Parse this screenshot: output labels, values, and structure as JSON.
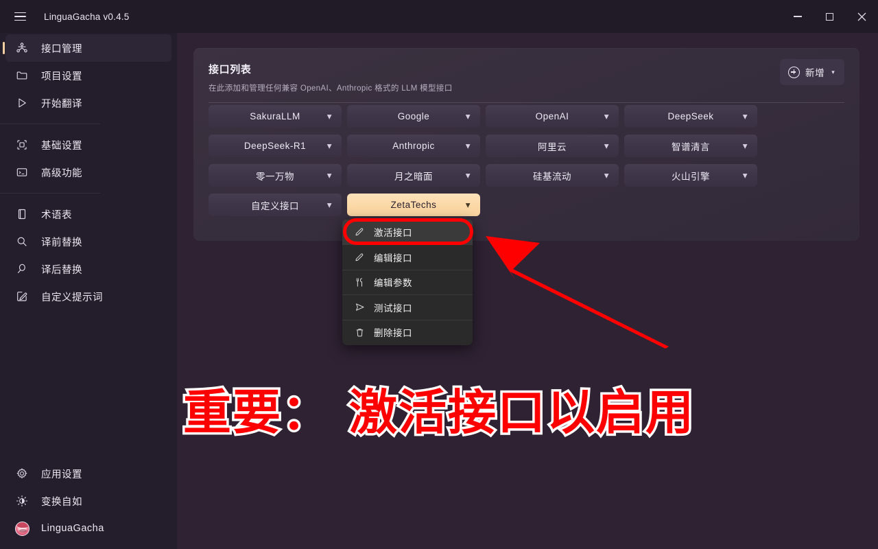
{
  "window": {
    "title": "LinguaGacha v0.4.5",
    "menu_icon": "hamburger-icon",
    "controls": {
      "minimize": "minimize-icon",
      "maximize": "maximize-icon",
      "close": "close-icon"
    }
  },
  "sidebar": {
    "top_items": [
      {
        "label": "接口管理",
        "icon": "network-nodes-icon",
        "active": true
      },
      {
        "label": "项目设置",
        "icon": "folder-icon",
        "active": false
      },
      {
        "label": "开始翻译",
        "icon": "play-triangle-icon",
        "active": false
      }
    ],
    "mid_items": [
      {
        "label": "基础设置",
        "icon": "cube-outline-icon",
        "active": false
      },
      {
        "label": "高级功能",
        "icon": "terminal-icon",
        "active": false
      }
    ],
    "tool_items": [
      {
        "label": "术语表",
        "icon": "book-icon",
        "active": false
      },
      {
        "label": "译前替换",
        "icon": "search-icon",
        "active": false
      },
      {
        "label": "译后替换",
        "icon": "search-alt-icon",
        "active": false
      },
      {
        "label": "自定义提示词",
        "icon": "edit-square-icon",
        "active": false
      }
    ],
    "bottom_items": [
      {
        "label": "应用设置",
        "icon": "gear-icon",
        "active": false
      },
      {
        "label": "变换自如",
        "icon": "brightness-icon",
        "active": false
      },
      {
        "label": "LinguaGacha",
        "icon": "avatar",
        "active": false
      }
    ]
  },
  "card": {
    "title": "接口列表",
    "subtitle": "在此添加和管理任何兼容 OpenAI、Anthropic 格式的 LLM 模型接口",
    "add_button": {
      "label": "新增",
      "icon": "plus-circle-icon",
      "caret": "chevron-down-icon"
    }
  },
  "interfaces": [
    {
      "label": "SakuraLLM",
      "active": false
    },
    {
      "label": "Google",
      "active": false
    },
    {
      "label": "OpenAI",
      "active": false
    },
    {
      "label": "DeepSeek",
      "active": false
    },
    {
      "label": "DeepSeek-R1",
      "active": false
    },
    {
      "label": "Anthropic",
      "active": false
    },
    {
      "label": "阿里云",
      "active": false
    },
    {
      "label": "智谱清言",
      "active": false
    },
    {
      "label": "零一万物",
      "active": false
    },
    {
      "label": "月之暗面",
      "active": false
    },
    {
      "label": "硅基流动",
      "active": false
    },
    {
      "label": "火山引擎",
      "active": false
    },
    {
      "label": "自定义接口",
      "active": false
    },
    {
      "label": "ZetaTechs",
      "active": true
    }
  ],
  "context_menu": {
    "items": [
      {
        "label": "激活接口",
        "icon": "pencil-icon",
        "highlighted": true
      },
      {
        "label": "编辑接口",
        "icon": "pencil-icon",
        "highlighted": false
      },
      {
        "label": "编辑参数",
        "icon": "sliders-icon",
        "highlighted": false
      },
      {
        "label": "测试接口",
        "icon": "send-icon",
        "highlighted": false
      },
      {
        "label": "删除接口",
        "icon": "trash-icon",
        "highlighted": false
      }
    ]
  },
  "annotation": {
    "text_part1": "重要：",
    "text_part2": "激活接口以启用",
    "color": "#fe0000",
    "outline_color": "#ffffff",
    "arrow": "red-arrow-pointing-up-left",
    "highlight_box": "red-rounded-rectangle"
  },
  "colors": {
    "titlebar_bg": "#201b27",
    "sidebar_bg": "#241d2b",
    "main_bg": "#2e2233",
    "card_bg": "#372e3d",
    "button_bg": "#3e3548",
    "accent": "#fbd8a6",
    "menu_bg": "#2a2a2a",
    "annotation_red": "#fe0000"
  }
}
